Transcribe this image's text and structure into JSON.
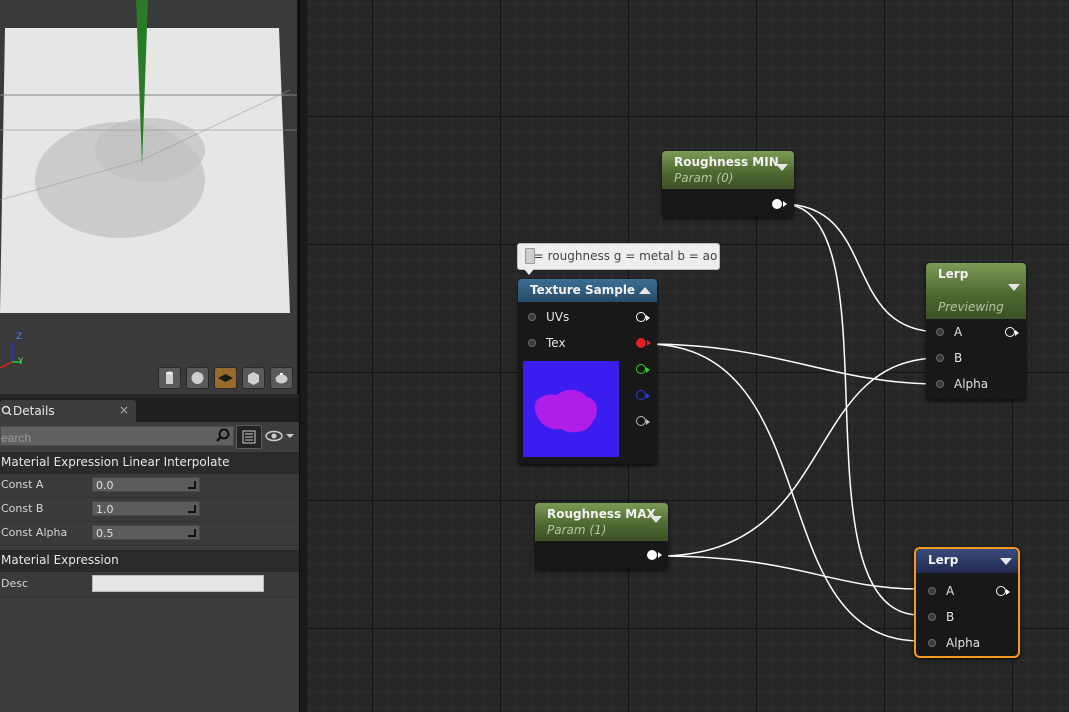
{
  "details": {
    "tab_label": "Details",
    "tab_close": "×",
    "search_placeholder": "earch",
    "categories": [
      {
        "title": "Material Expression Linear Interpolate",
        "props": [
          {
            "name": "Const A",
            "value": "0.0"
          },
          {
            "name": "Const B",
            "value": "1.0"
          },
          {
            "name": "Const Alpha",
            "value": "0.5"
          }
        ]
      },
      {
        "title": "Material Expression",
        "props": [
          {
            "name": "Desc",
            "value": ""
          }
        ]
      }
    ]
  },
  "viewport": {
    "axis_z": "Z",
    "axis_y": "Y",
    "buttons": [
      "cylinder-icon",
      "sphere-icon",
      "plane-icon",
      "cube-icon",
      "teapot-icon"
    ],
    "active_button": "plane-icon"
  },
  "comment": {
    "text": "r = roughness g = metal b = ao"
  },
  "nodes": {
    "roughness_min": {
      "title": "Roughness MIN",
      "subtitle": "Param (0)"
    },
    "texture_sample": {
      "title": "Texture Sample",
      "pins_in": [
        "UVs",
        "Tex"
      ]
    },
    "roughness_max": {
      "title": "Roughness MAX",
      "subtitle": "Param (1)"
    },
    "lerp_preview": {
      "title": "Lerp",
      "subtitle": "Previewing",
      "pins_in": [
        "A",
        "B",
        "Alpha"
      ]
    },
    "lerp_selected": {
      "title": "Lerp",
      "pins_in": [
        "A",
        "B",
        "Alpha"
      ]
    }
  },
  "colors": {
    "selection": "#f59a1f",
    "pin_red": "#e02020",
    "pin_green": "#2ad42a",
    "pin_blue": "#2a3ad4",
    "wire": "#ffffff"
  }
}
